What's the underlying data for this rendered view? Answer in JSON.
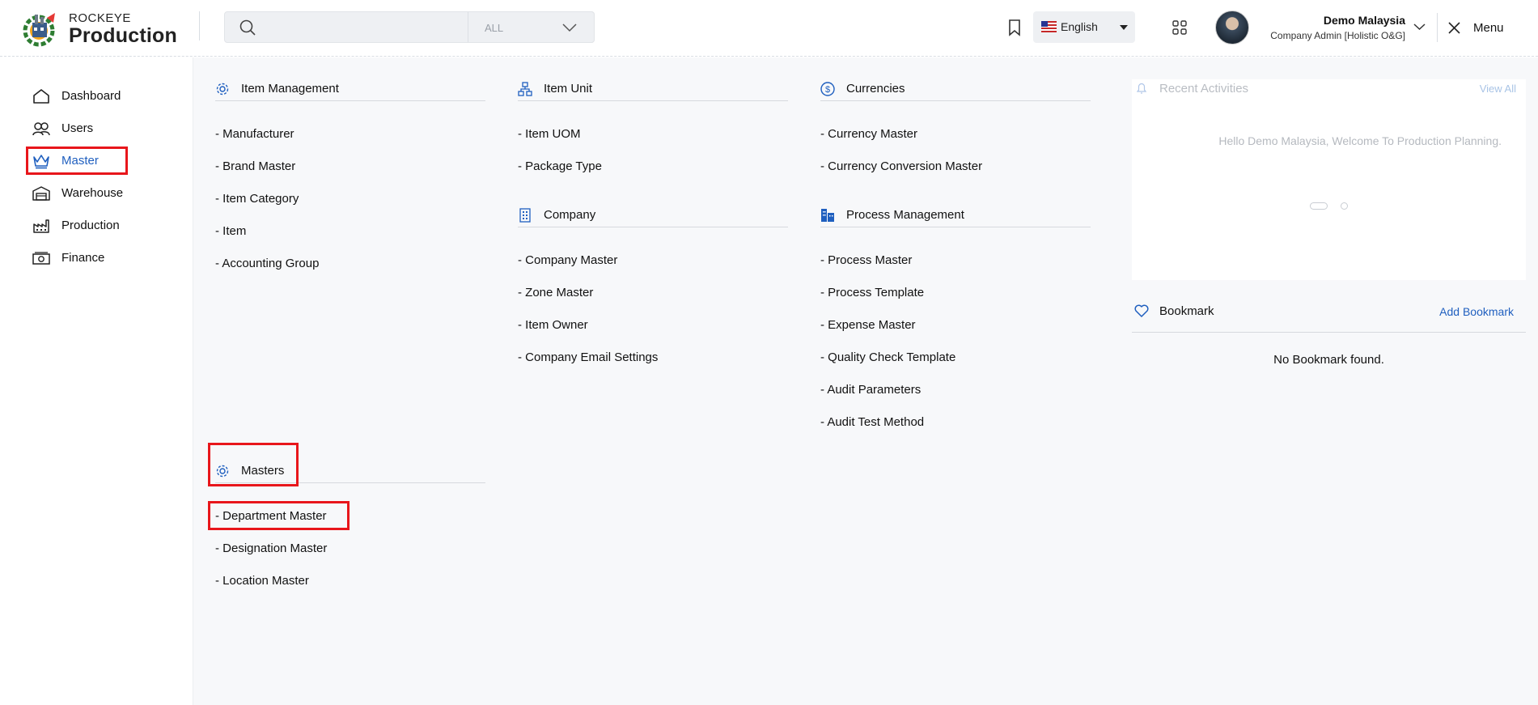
{
  "header": {
    "brand_top": "ROCKEYE",
    "brand_main": "Production",
    "search": {
      "placeholder": "",
      "value": "",
      "scope": "ALL"
    },
    "language": "English",
    "user": {
      "name": "Demo Malaysia",
      "role": "Company Admin [Holistic O&G]"
    },
    "menu_label": "Menu"
  },
  "sidebar": {
    "items": [
      {
        "label": "Dashboard",
        "icon": "home-icon"
      },
      {
        "label": "Users",
        "icon": "users-icon"
      },
      {
        "label": "Master",
        "icon": "crown-icon",
        "active": true
      },
      {
        "label": "Warehouse",
        "icon": "warehouse-icon"
      },
      {
        "label": "Production",
        "icon": "factory-icon"
      },
      {
        "label": "Finance",
        "icon": "money-icon"
      }
    ]
  },
  "sections": {
    "item_management": {
      "title": "Item Management",
      "links": [
        "- Manufacturer",
        "- Brand Master",
        "- Item Category",
        "- Item",
        "- Accounting Group"
      ]
    },
    "item_unit": {
      "title": "Item Unit",
      "links": [
        "- Item UOM",
        "- Package Type"
      ]
    },
    "currencies": {
      "title": "Currencies",
      "links": [
        "- Currency Master",
        "- Currency Conversion Master"
      ]
    },
    "company": {
      "title": "Company",
      "links": [
        "- Company Master",
        "- Zone Master",
        "- Item Owner",
        "- Company Email Settings"
      ]
    },
    "process_management": {
      "title": "Process Management",
      "links": [
        "- Process Master",
        "- Process Template",
        "- Expense Master",
        "- Quality Check Template",
        "- Audit Parameters",
        "- Audit Test Method"
      ]
    },
    "masters": {
      "title": "Masters",
      "links": [
        "- Department Master",
        "- Designation Master",
        "- Location Master"
      ]
    }
  },
  "recent_activities": {
    "title": "Recent Activities",
    "view_all": "View All",
    "message": "Hello Demo Malaysia, Welcome To Production Planning."
  },
  "bookmark": {
    "title": "Bookmark",
    "add_label": "Add Bookmark",
    "empty_message": "No Bookmark found."
  },
  "colors": {
    "accent": "#1f5fbf",
    "highlight": "#e8161b",
    "panel_bg": "#f7f8fa"
  }
}
